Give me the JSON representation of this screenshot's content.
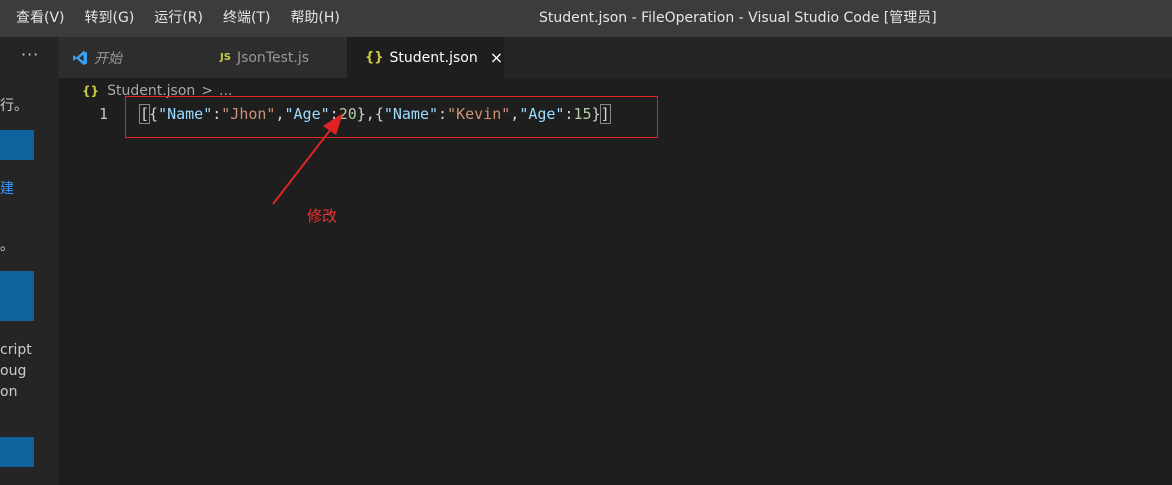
{
  "menu": {
    "items": [
      "查看(V)",
      "转到(G)",
      "运行(R)",
      "终端(T)",
      "帮助(H)"
    ]
  },
  "window_title": "Student.json - FileOperation - Visual Studio Code [管理员]",
  "sidebar": {
    "more": "···",
    "texts": [
      "行。",
      "建",
      "。",
      "cript",
      "oug",
      "on"
    ]
  },
  "tabs": [
    {
      "label": "开始",
      "icon": "vscode-icon",
      "active": false
    },
    {
      "label": "JsonTest.js",
      "icon_text": "JS",
      "active": false
    },
    {
      "label": "Student.json",
      "icon_text": "{}",
      "active": true,
      "close": "×"
    }
  ],
  "breadcrumb": {
    "icon_text": "{}",
    "file": "Student.json",
    "sep": ">",
    "more": "..."
  },
  "editor": {
    "line_number": "1",
    "code": "[{\"Name\":\"Jhon\",\"Age\":20},{\"Name\":\"Kevin\",\"Age\":15}]"
  },
  "annotation": {
    "label": "修改",
    "color": "#f23030"
  },
  "colors": {
    "accent_blue": "#0e639c",
    "json_icon": "#cbcb41",
    "highlight_red": "#e02424"
  }
}
